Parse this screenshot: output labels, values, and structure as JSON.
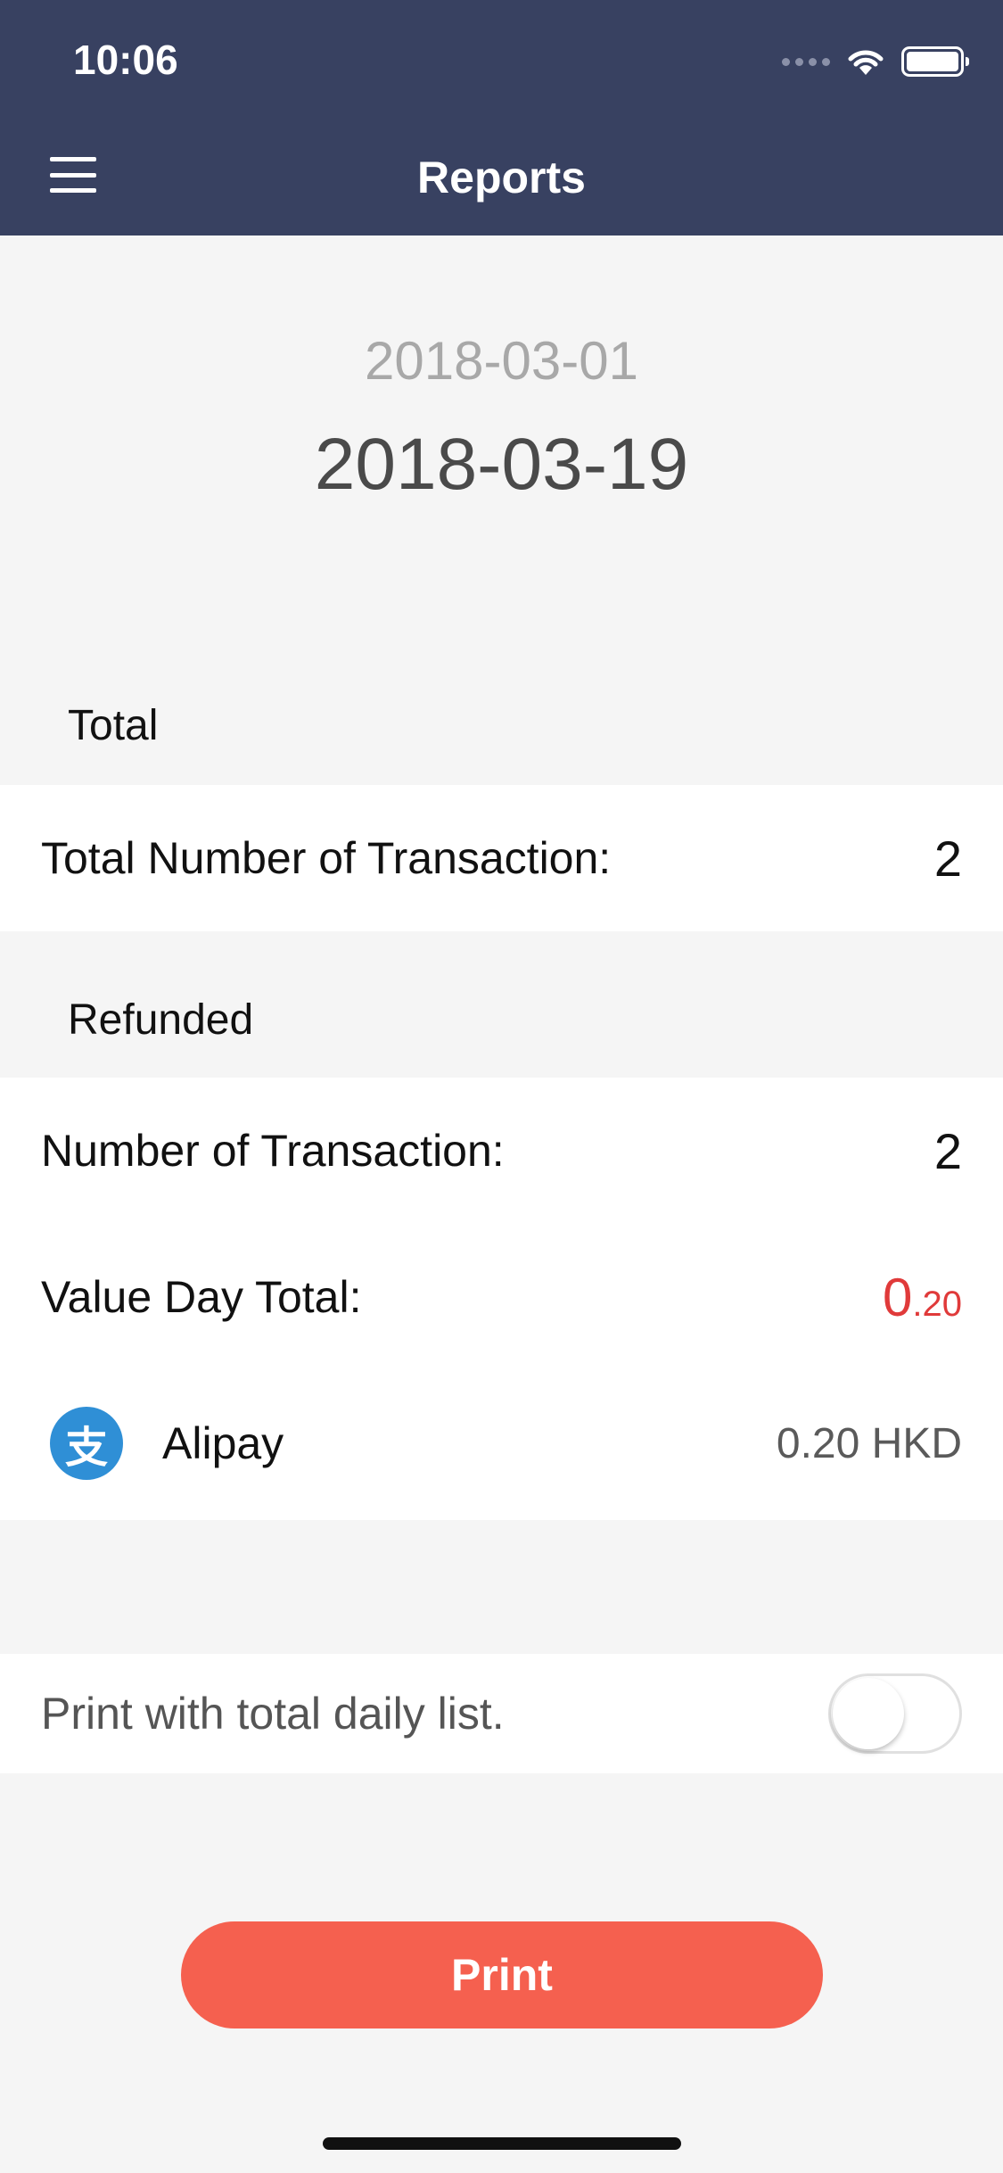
{
  "status_bar": {
    "time": "10:06"
  },
  "header": {
    "title": "Reports",
    "menu_icon": "hamburger-icon"
  },
  "dates": {
    "start": "2018-03-01",
    "end": "2018-03-19"
  },
  "total_section": {
    "heading": "Total",
    "rows": [
      {
        "label": "Total Number of Transaction:",
        "value": "2"
      }
    ]
  },
  "refunded_section": {
    "heading": "Refunded",
    "transactions": {
      "label": "Number of Transaction:",
      "value": "2"
    },
    "value_day_total": {
      "label": "Value Day Total:",
      "int_part": "0",
      "dec_part": ".20",
      "color": "#e03a3a"
    },
    "methods": [
      {
        "name": "Alipay",
        "icon_glyph": "支",
        "icon_name": "alipay-icon",
        "icon_color": "#2f8fd6",
        "amount": "0.20 HKD"
      }
    ]
  },
  "print_option": {
    "label": "Print with total daily list.",
    "toggle_on": false
  },
  "print_button": {
    "label": "Print",
    "color": "#f5604f"
  },
  "colors": {
    "header_bg": "#384161",
    "page_bg": "#f5f5f5"
  }
}
